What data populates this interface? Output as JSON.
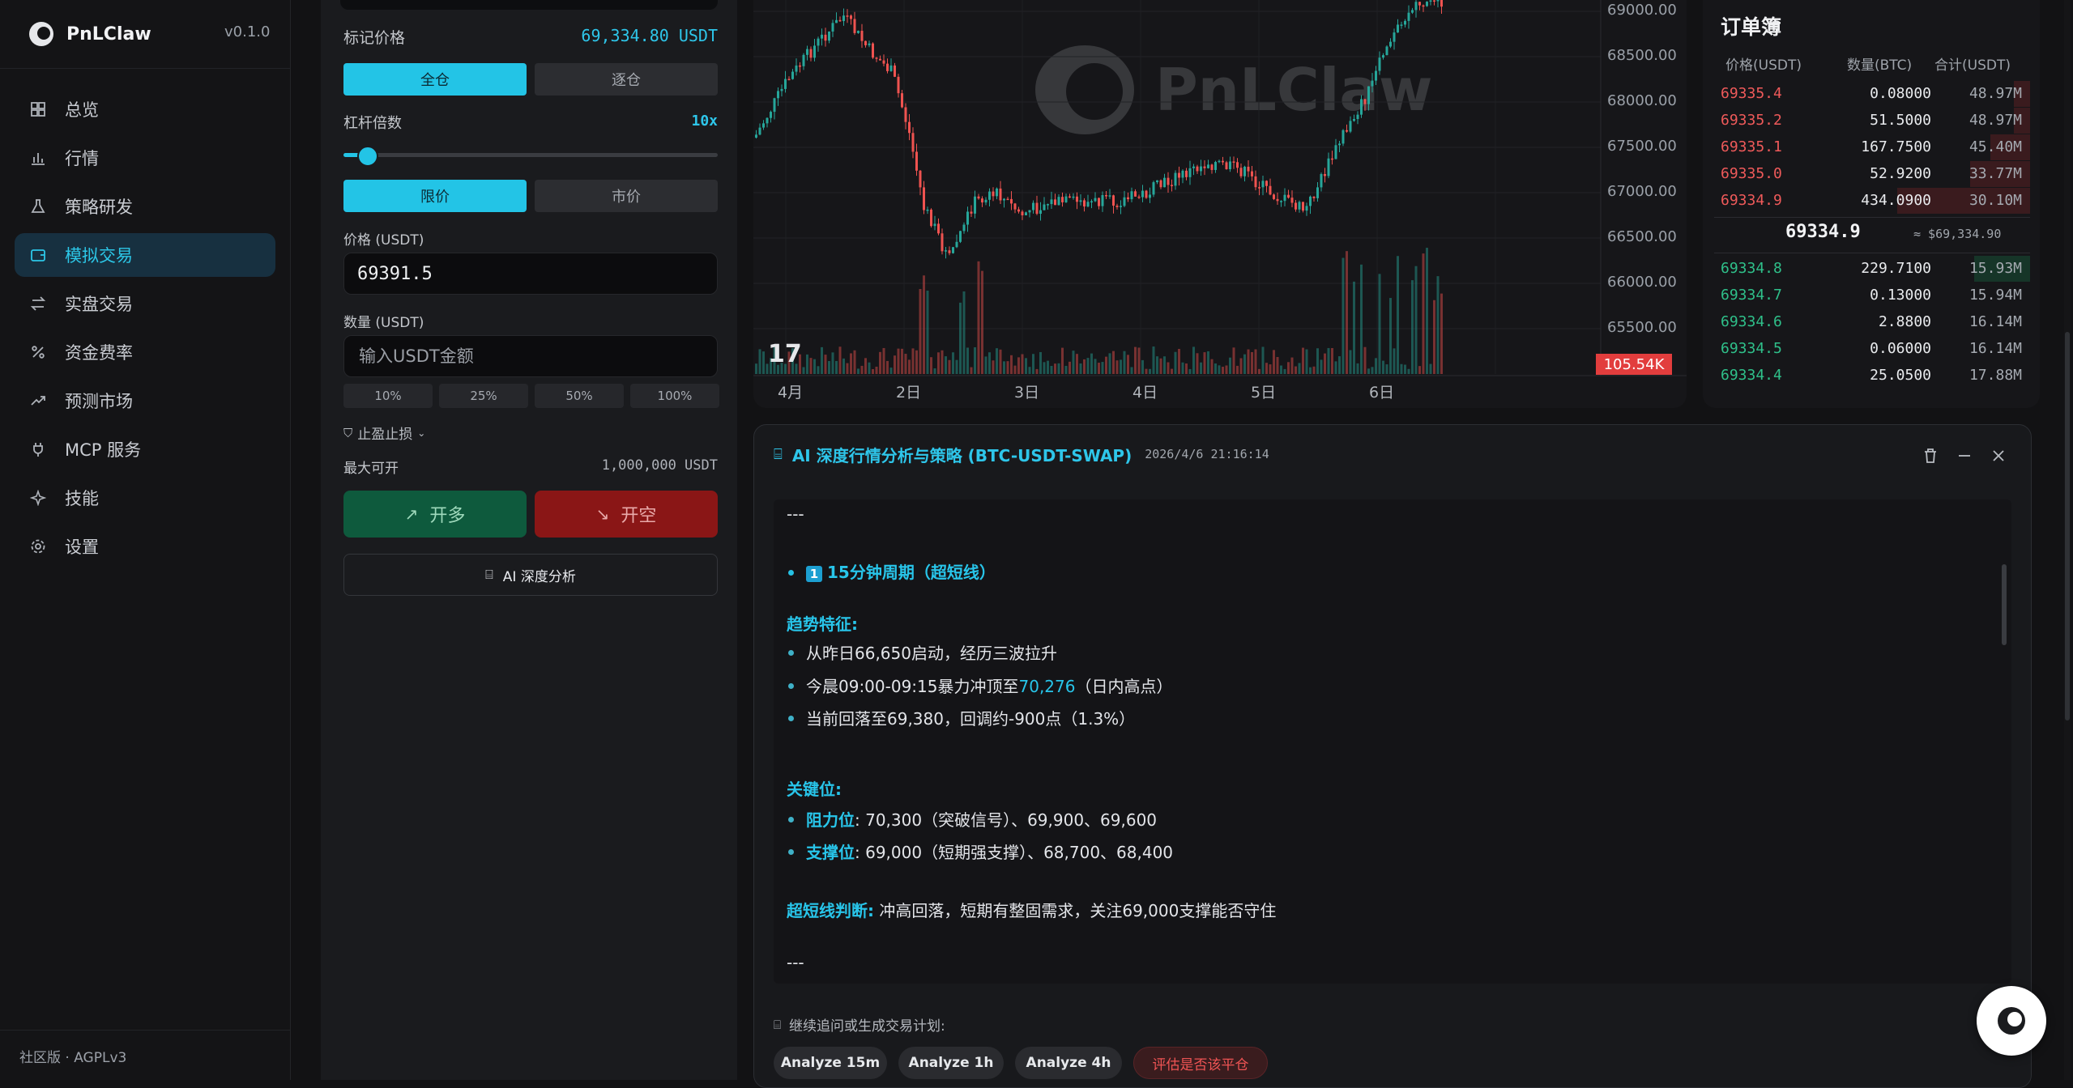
{
  "app": {
    "name": "PnLClaw",
    "version": "v0.1.0",
    "edition": "社区版 · AGPLv3"
  },
  "sidebar": {
    "items": [
      {
        "label": "总览",
        "icon": "grid-icon"
      },
      {
        "label": "行情",
        "icon": "bar-chart-icon"
      },
      {
        "label": "策略研发",
        "icon": "flask-icon"
      },
      {
        "label": "模拟交易",
        "icon": "wallet-icon",
        "active": true
      },
      {
        "label": "实盘交易",
        "icon": "swap-icon"
      },
      {
        "label": "资金费率",
        "icon": "percent-icon"
      },
      {
        "label": "预测市场",
        "icon": "trend-icon"
      },
      {
        "label": "MCP 服务",
        "icon": "plug-icon"
      },
      {
        "label": "技能",
        "icon": "sparkle-icon"
      },
      {
        "label": "设置",
        "icon": "gear-icon"
      }
    ]
  },
  "order": {
    "mark_price_label": "标记价格",
    "mark_price_value": "69,334.80 USDT",
    "margin_cross": "全仓",
    "margin_isolated": "逐仓",
    "leverage_label": "杠杆倍数",
    "leverage_value": "10x",
    "leverage_fraction": 0.06,
    "type_limit": "限价",
    "type_market": "市价",
    "price_label": "价格 (USDT)",
    "price_value": "69391.5",
    "qty_label": "数量 (USDT)",
    "qty_placeholder": "输入USDT金额",
    "pct": [
      "10%",
      "25%",
      "50%",
      "100%"
    ],
    "tpsl_label": "止盈止损",
    "max_label": "最大可开",
    "max_value": "1,000,000 USDT",
    "long_label": "开多",
    "short_label": "开空",
    "ai_label": "AI 深度分析"
  },
  "chart": {
    "watermark": "PnLClaw",
    "tv_logo": "17",
    "price_ticks": [
      "69000.00",
      "68500.00",
      "68000.00",
      "67500.00",
      "67000.00",
      "66500.00",
      "66000.00",
      "65500.00"
    ],
    "volume_label": "105.54K",
    "dates": [
      "4月",
      "2日",
      "3日",
      "4日",
      "5日",
      "6日"
    ],
    "colors": {
      "up": "#26a69a",
      "down": "#ef5350"
    }
  },
  "orderbook": {
    "title": "订单簿",
    "headers": [
      "价格(USDT)",
      "数量(BTC)",
      "合计(USDT)"
    ],
    "asks": [
      {
        "price": "69335.4",
        "qty": "0.08000",
        "total": "48.97M",
        "depth": 0.12
      },
      {
        "price": "69335.2",
        "qty": "51.5000",
        "total": "48.97M",
        "depth": 0.12
      },
      {
        "price": "69335.1",
        "qty": "167.7500",
        "total": "45.40M",
        "depth": 0.3
      },
      {
        "price": "69335.0",
        "qty": "52.9200",
        "total": "33.77M",
        "depth": 0.45
      },
      {
        "price": "69334.9",
        "qty": "434.0900",
        "total": "30.10M",
        "depth": 1.0
      }
    ],
    "mid_price": "69334.9",
    "mid_sub": "≈ $69,334.90",
    "bids": [
      {
        "price": "69334.8",
        "qty": "229.7100",
        "total": "15.93M",
        "depth": 0.42
      },
      {
        "price": "69334.7",
        "qty": "0.13000",
        "total": "15.94M",
        "depth": 0.0
      },
      {
        "price": "69334.6",
        "qty": "2.8800",
        "total": "16.14M",
        "depth": 0.0
      },
      {
        "price": "69334.5",
        "qty": "0.06000",
        "total": "16.14M",
        "depth": 0.0
      },
      {
        "price": "69334.4",
        "qty": "25.0500",
        "total": "17.88M",
        "depth": 0.0
      }
    ]
  },
  "ai": {
    "title": "AI 深度行情分析与策略 (BTC-USDT-SWAP)",
    "timestamp": "2026/4/6 21:16:14",
    "sep": "---",
    "period_num": "1",
    "period_title": "15分钟周期（超短线）",
    "trend_heading": "趋势特征:",
    "trend_1": "从昨日66,650启动，经历三波拉升",
    "trend_2_pre": "今晨09:00-09:15暴力冲顶至",
    "trend_2_hl": "70,276",
    "trend_2_post": "（日内高点）",
    "trend_3": "当前回落至69,380，回调约-900点（1.3%）",
    "key_heading": "关键位:",
    "res_label": "阻力位",
    "res_text": ": 70,300（突破信号）、69,900、69,600",
    "sup_label": "支撑位",
    "sup_text": ": 69,000（短期强支撑）、68,700、68,400",
    "judge_label": "超短线判断:",
    "judge_text": " 冲高回落，短期有整固需求，关注69,000支撑能否守住",
    "sep2": "---",
    "followup": "继续追问或生成交易计划:",
    "chips": [
      "Analyze 15m",
      "Analyze 1h",
      "Analyze 4h",
      "评估是否该平仓"
    ]
  }
}
